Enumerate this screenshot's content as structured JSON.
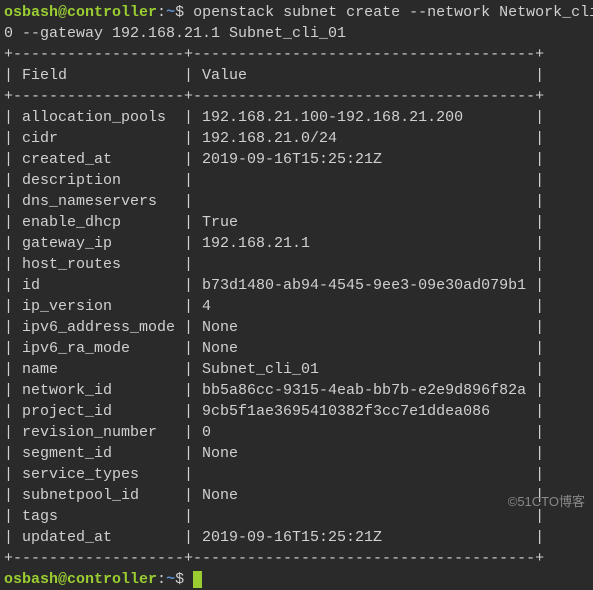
{
  "prompt": {
    "user": "osbash",
    "at": "@",
    "host": "controller",
    "colon": ":",
    "path": "~",
    "dollar": "$"
  },
  "command": {
    "line1": " openstack subnet create --network Network_cli",
    "line2": "0 --gateway 192.168.21.1 Subnet_cli_01"
  },
  "headers": {
    "field": "Field",
    "value": "Value"
  },
  "rows": [
    {
      "field": "allocation_pools",
      "value": "192.168.21.100-192.168.21.200"
    },
    {
      "field": "cidr",
      "value": "192.168.21.0/24"
    },
    {
      "field": "created_at",
      "value": "2019-09-16T15:25:21Z"
    },
    {
      "field": "description",
      "value": ""
    },
    {
      "field": "dns_nameservers",
      "value": ""
    },
    {
      "field": "enable_dhcp",
      "value": "True"
    },
    {
      "field": "gateway_ip",
      "value": "192.168.21.1"
    },
    {
      "field": "host_routes",
      "value": ""
    },
    {
      "field": "id",
      "value": "b73d1480-ab94-4545-9ee3-09e30ad079b1"
    },
    {
      "field": "ip_version",
      "value": "4"
    },
    {
      "field": "ipv6_address_mode",
      "value": "None"
    },
    {
      "field": "ipv6_ra_mode",
      "value": "None"
    },
    {
      "field": "name",
      "value": "Subnet_cli_01"
    },
    {
      "field": "network_id",
      "value": "bb5a86cc-9315-4eab-bb7b-e2e9d896f82a"
    },
    {
      "field": "project_id",
      "value": "9cb5f1ae3695410382f3cc7e1ddea086"
    },
    {
      "field": "revision_number",
      "value": "0"
    },
    {
      "field": "segment_id",
      "value": "None"
    },
    {
      "field": "service_types",
      "value": ""
    },
    {
      "field": "subnetpool_id",
      "value": "None"
    },
    {
      "field": "tags",
      "value": ""
    },
    {
      "field": "updated_at",
      "value": "2019-09-16T15:25:21Z"
    }
  ],
  "border": {
    "top": "+-------------------+--------------------------------------+",
    "header": "| Field             | Value                                |",
    "bottom": "+-------------------+--------------------------------------+"
  },
  "watermark": "©51CTO博客"
}
